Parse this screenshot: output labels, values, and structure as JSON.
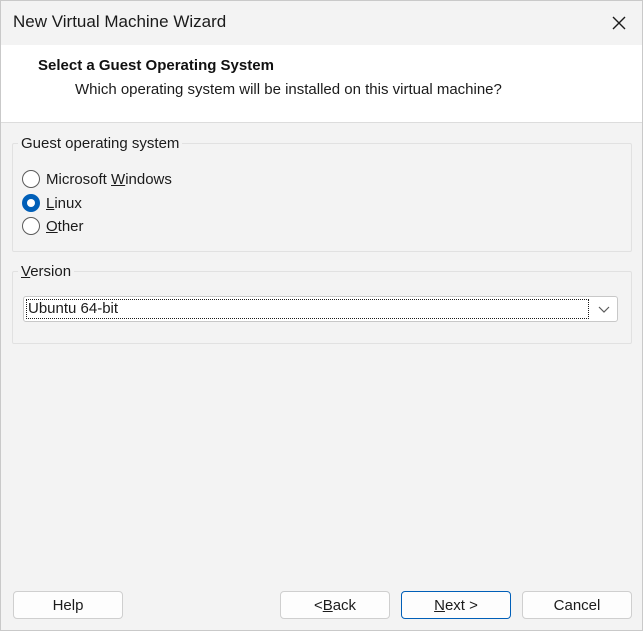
{
  "window": {
    "title": "New Virtual Machine Wizard"
  },
  "header": {
    "title": "Select a Guest Operating System",
    "subtitle": "Which operating system will be installed on this virtual machine?"
  },
  "guest_os": {
    "group_label": "Guest operating system",
    "options": [
      {
        "pre": "Microsoft ",
        "key": "W",
        "post": "indows",
        "checked": false
      },
      {
        "pre": "",
        "key": "L",
        "post": "inux",
        "checked": true
      },
      {
        "pre": "",
        "key": "O",
        "post": "ther",
        "checked": false
      }
    ]
  },
  "version": {
    "group_label_key": "V",
    "group_label_rest": "ersion",
    "selected": "Ubuntu 64-bit"
  },
  "buttons": {
    "help": "Help",
    "back_pre": "< ",
    "back_key": "B",
    "back_post": "ack",
    "next_key": "N",
    "next_post": "ext >",
    "cancel": "Cancel"
  },
  "colors": {
    "accent": "#005fb8",
    "window_bg": "#f3f3f3",
    "header_bg": "#ffffff"
  },
  "icons": {
    "close": "close-icon",
    "dropdown": "chevron-down-icon"
  }
}
